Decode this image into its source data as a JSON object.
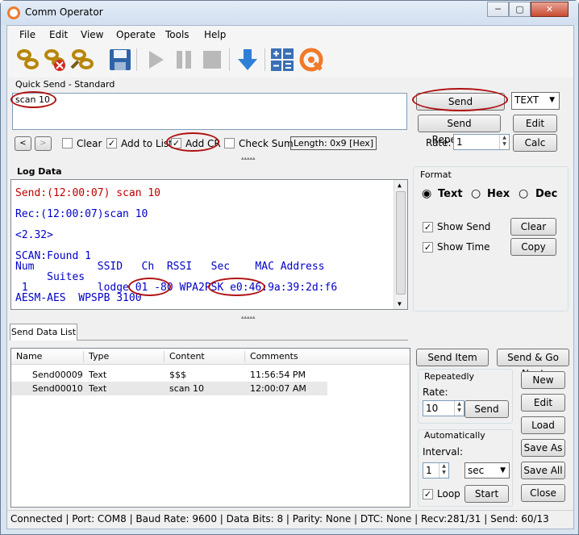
{
  "app": {
    "title": "Comm Operator"
  },
  "window_buttons": {
    "minimize": "─",
    "maximize": "▢",
    "close": "✕"
  },
  "menu": [
    "File",
    "Edit",
    "View",
    "Operate",
    "Tools",
    "Help"
  ],
  "quick_send": {
    "group_label": "Quick Send - Standard",
    "text": "scan 10",
    "send": "Send",
    "send_repeatedly": "Send Repeatedly",
    "format_select": "TEXT",
    "edit": "Edit",
    "calc": "Calc",
    "rate_label": "Rate:",
    "rate_value": "1",
    "nav_prev": "<",
    "nav_next": ">",
    "clear": "Clear",
    "add_to_list": "Add to List",
    "add_cr": "Add CR",
    "check_sum": "Check Sum",
    "length": "Length: 0x9 [Hex]"
  },
  "log": {
    "label": "Log Data",
    "lines": [
      "Send:(12:00:07) scan 10",
      "Rec:(12:00:07)scan 10",
      "<2.32>",
      "SCAN:Found 1",
      "Num          SSID   Ch  RSSI   Sec    MAC Address",
      "     Suites",
      " 1           lodge 01 -80 WPA2PSK e0:46:9a:39:2d:f6",
      "AESM-AES  WPSPB 3100"
    ]
  },
  "format": {
    "label": "Format",
    "text": "Text",
    "hex": "Hex",
    "dec": "Dec",
    "show_send": "Show Send",
    "show_time": "Show Time",
    "clear": "Clear",
    "copy": "Copy"
  },
  "send_list": {
    "tab": "Send Data List",
    "columns": [
      "Name",
      "Type",
      "Content",
      "Comments"
    ],
    "rows": [
      {
        "name": "Send00009",
        "type": "Text",
        "content": "$$$",
        "comments": "11:56:54 PM"
      },
      {
        "name": "Send00010",
        "type": "Text",
        "content": "scan 10",
        "comments": "12:00:07 AM"
      }
    ],
    "send_item": "Send Item",
    "send_go_next": "Send & Go Next",
    "repeatedly": "Repeatedly",
    "rate_label": "Rate:",
    "rate_value": "10",
    "send": "Send",
    "automatically": "Automatically",
    "interval_label": "Interval:",
    "interval_value": "1",
    "interval_unit": "sec",
    "loop": "Loop",
    "start": "Start",
    "new": "New",
    "edit": "Edit",
    "load": "Load",
    "save_as": "Save As",
    "save_all": "Save All",
    "close": "Close"
  },
  "status": "Connected | Port: COM8 | Baud Rate: 9600 | Data Bits: 8 | Parity: None | DTC: None | Recv:281/31 | Send: 60/13",
  "colors": {
    "send_text": "#c00000",
    "rec_text": "#0000c8",
    "highlight_ring": "#b01010"
  }
}
